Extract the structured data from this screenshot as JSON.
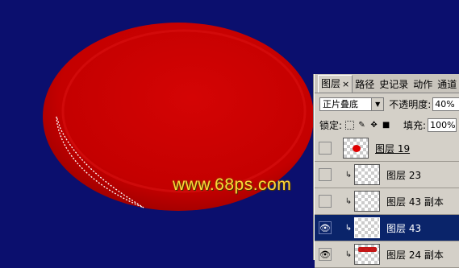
{
  "canvas": {
    "background": "#0b0f6e",
    "ellipse_color": "#c80000"
  },
  "watermark": "www.68ps.com",
  "panel": {
    "tabs": [
      {
        "label": "图层",
        "close": "×"
      },
      {
        "label": "路径"
      },
      {
        "label": "史记录"
      },
      {
        "label": "动作"
      },
      {
        "label": "通道"
      }
    ],
    "blend_mode": "正片叠底",
    "opacity_label": "不透明度:",
    "opacity_value": "40%",
    "lock_label": "锁定:",
    "fill_label": "填充:",
    "fill_value": "100%",
    "layers": [
      {
        "name": "图层 19",
        "visible": false,
        "clipped": false,
        "thumb": "red-dot",
        "selected": false
      },
      {
        "name": "图层 23",
        "visible": false,
        "clipped": true,
        "thumb": "empty",
        "selected": false
      },
      {
        "name": "图层 43 副本",
        "visible": false,
        "clipped": true,
        "thumb": "empty",
        "selected": false
      },
      {
        "name": "图层 43",
        "visible": true,
        "clipped": true,
        "thumb": "empty",
        "selected": true
      },
      {
        "name": "图层 24 副本",
        "visible": true,
        "clipped": true,
        "thumb": "red-bar",
        "selected": false
      }
    ]
  }
}
